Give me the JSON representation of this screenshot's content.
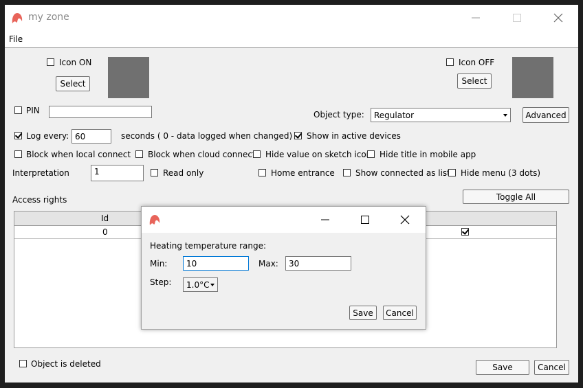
{
  "window": {
    "title": "my zone",
    "menu": [
      "File"
    ]
  },
  "icon_on": {
    "checkbox_label": "Icon ON",
    "checked": false,
    "select_label": "Select"
  },
  "icon_off": {
    "checkbox_label": "Icon OFF",
    "checked": false,
    "select_label": "Select"
  },
  "pin": {
    "label": "PIN",
    "value": ""
  },
  "object_type": {
    "label": "Object type:",
    "value": "Regulator",
    "advanced_label": "Advanced"
  },
  "log": {
    "label": "Log every:",
    "value": "60",
    "suffix": "seconds ( 0 - data logged when changed)",
    "checked": true
  },
  "show_active": {
    "label": "Show in active devices",
    "checked": true
  },
  "options_row1": [
    {
      "label": "Block when local connect",
      "checked": false
    },
    {
      "label": "Block when cloud connect",
      "checked": false
    },
    {
      "label": "Hide value on sketch icon",
      "checked": false
    },
    {
      "label": "Hide title in mobile app",
      "checked": false
    }
  ],
  "interpretation": {
    "label": "Interpretation",
    "value": "1"
  },
  "options_row2": [
    {
      "label": "Read only",
      "checked": false
    },
    {
      "label": "Home entrance",
      "checked": false
    },
    {
      "label": "Show connected as list",
      "checked": false
    },
    {
      "label": "Hide menu (3 dots)",
      "checked": false
    }
  ],
  "access": {
    "label": "Access rights",
    "toggle_all": "Toggle All",
    "columns": [
      "Id"
    ],
    "rows": [
      {
        "id": "0",
        "checked": true
      }
    ]
  },
  "object_deleted": {
    "label": "Object is deleted",
    "checked": false
  },
  "footer": {
    "save": "Save",
    "cancel": "Cancel"
  },
  "dialog": {
    "heading": "Heating temperature range:",
    "min_label": "Min:",
    "min_value": "10",
    "max_label": "Max:",
    "max_value": "30",
    "step_label": "Step:",
    "step_value": "1.0°C",
    "save": "Save",
    "cancel": "Cancel"
  },
  "colors": {
    "swatch": "#707070",
    "logo": "#e8645a",
    "window_bg": "#f0f0f0"
  }
}
